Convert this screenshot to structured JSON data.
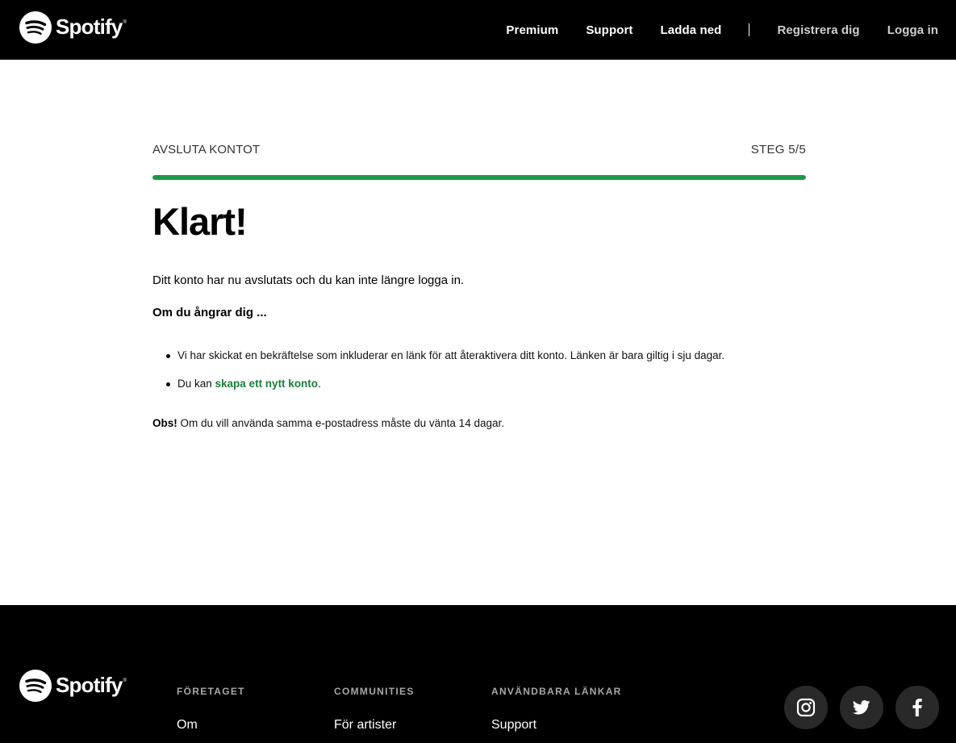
{
  "header": {
    "logo_text": "Spotify",
    "nav": {
      "premium": "Premium",
      "support": "Support",
      "download": "Ladda ned",
      "signup": "Registrera dig",
      "login": "Logga in"
    }
  },
  "flow": {
    "title": "AVSLUTA KONTOT",
    "step": "STEG 5/5",
    "progress": 1.0
  },
  "content": {
    "heading": "Klart!",
    "intro": "Ditt konto har nu avslutats och du kan inte längre logga in.",
    "regret": "Om du ångrar dig ...",
    "bullet1": "Vi har skickat en bekräftelse som inkluderar en länk för att återaktivera ditt konto. Länken är bara giltig i sju dagar.",
    "bullet2_prefix": "Du kan ",
    "bullet2_link": "skapa ett nytt konto",
    "bullet2_suffix": ".",
    "note_label": "Obs!",
    "note_text": " Om du vill använda samma e-postadress måste du vänta 14 dagar."
  },
  "footer": {
    "logo_text": "Spotify",
    "columns": [
      {
        "heading": "FÖRETAGET",
        "link": "Om"
      },
      {
        "heading": "COMMUNITIES",
        "link": "För artister"
      },
      {
        "heading": "ANVÄNDBARA LÄNKAR",
        "link": "Support"
      }
    ],
    "social": [
      "instagram-icon",
      "twitter-icon",
      "facebook-icon"
    ]
  },
  "colors": {
    "accent": "#1e9847",
    "link": "#1a7f3a",
    "header_bg": "#000000",
    "footer_bg": "#000000"
  }
}
